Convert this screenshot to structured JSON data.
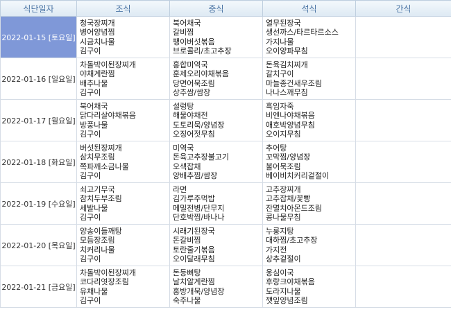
{
  "headers": [
    "식단일자",
    "조식",
    "중식",
    "석식",
    "간식"
  ],
  "rows": [
    {
      "date": "2022-01-15 [토요일]",
      "selected": true,
      "breakfast": [
        "청국장찌개",
        "병어양념찜",
        "시금치나물",
        "김구이"
      ],
      "lunch": [
        "북어채국",
        "갈비찜",
        "팽이버섯볶음",
        "브로콜리/초고추장"
      ],
      "dinner": [
        "열무된장국",
        "생선까스/타르타르소스",
        "가지나물",
        "오이양파무침"
      ],
      "snack": []
    },
    {
      "date": "2022-01-16 [일요일]",
      "selected": false,
      "breakfast": [
        "차돌박이된장찌개",
        "야채계란찜",
        "배추나물",
        "김구이"
      ],
      "lunch": [
        "홍합미역국",
        "훈제오리야채볶음",
        "당면어묵조림",
        "상추쌈/쌈장"
      ],
      "dinner": [
        "돈육김치찌개",
        "갈치구이",
        "마늘종건새우조림",
        "나나스깨무침"
      ],
      "snack": []
    },
    {
      "date": "2022-01-17 [월요일]",
      "selected": false,
      "breakfast": [
        "북어채국",
        "닭다리살야채볶음",
        "방풍나물",
        "김구이"
      ],
      "lunch": [
        "설렁탕",
        "해물야채전",
        "도토리묵/양념장",
        "오징어젓무침"
      ],
      "dinner": [
        "흑임자죽",
        "비엔나야채볶음",
        "애호박양념무침",
        "오이지무침"
      ],
      "snack": []
    },
    {
      "date": "2022-01-18 [화요일]",
      "selected": false,
      "breakfast": [
        "버섯된장찌개",
        "삼치무조림",
        "쪽파깨소금나물",
        "김구이"
      ],
      "lunch": [
        "미역국",
        "돈육고추장불고기",
        "오색잡채",
        "양배추찜/쌈장"
      ],
      "dinner": [
        "추어탕",
        "꼬막찜/양념장",
        "불어묵조림",
        "베이비치커리겉절이"
      ],
      "snack": []
    },
    {
      "date": "2022-01-19 [수요일]",
      "selected": false,
      "breakfast": [
        "쇠고기무국",
        "참치두부조림",
        "세발나물",
        "김구이"
      ],
      "lunch": [
        "라면",
        "김가루주먹밥",
        "메밀전병/단무지",
        "단호박찜/바나나"
      ],
      "dinner": [
        "고추장찌개",
        "고추잡채/꽃빵",
        "잔멸치아몬드조림",
        "콩나물무침"
      ],
      "snack": []
    },
    {
      "date": "2022-01-20 [목요일]",
      "selected": false,
      "breakfast": [
        "양송이들깨탕",
        "모듬장조림",
        "치커리나물",
        "김구이"
      ],
      "lunch": [
        "시래기된장국",
        "돈갈비찜",
        "토란줄기볶음",
        "오이달래무침"
      ],
      "dinner": [
        "누룽지탕",
        "대하찜/초고추장",
        "가지전",
        "상추겉절이"
      ],
      "snack": []
    },
    {
      "date": "2022-01-21 [금요일]",
      "selected": false,
      "breakfast": [
        "차돌박이된장찌개",
        "코다리엿장조림",
        "유채나물",
        "김구이"
      ],
      "lunch": [
        "돈등뼈탕",
        "날치알계란찜",
        "홍방개묵/양념장",
        "숙주나물"
      ],
      "dinner": [
        "옹심이국",
        "후랑크야채볶음",
        "도라지나물",
        "깻잎양념조림"
      ],
      "snack": []
    }
  ]
}
